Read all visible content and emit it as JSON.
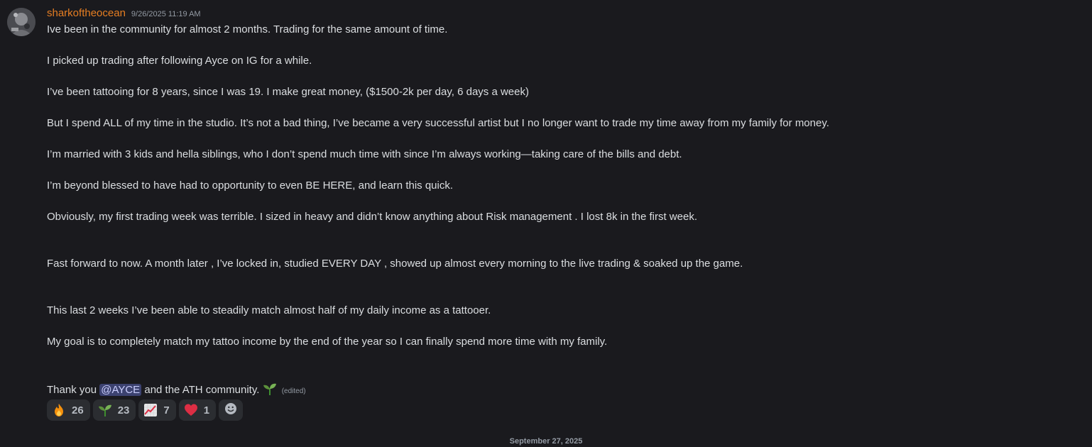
{
  "message": {
    "username": "sharkoftheocean",
    "timestamp": "9/26/2025 11:19 AM",
    "username_color": "#e67e22",
    "lines": [
      "Ive been in the community for almost 2 months. Trading for the same amount of time.",
      "I picked up trading after following Ayce on IG for a while.",
      "I’ve been tattooing for 8 years, since I was 19. I make great money, ($1500-2k per day, 6 days a week)",
      "But I spend ALL of my time in the studio. It’s not a bad thing, I’ve became a very successful artist but I no longer want to trade my time away from my family for money.",
      "I’m married with 3 kids and hella siblings, who I don’t spend much time with since I’m always working—taking care of the bills and debt.",
      "I’m beyond blessed to have had to opportunity to even BE HERE, and learn this quick.",
      "Obviously, my first trading week was terrible. I sized in heavy and didn’t know anything about Risk management . I lost 8k in the first week.",
      "Fast forward to now. A month later , I’ve locked in, studied EVERY DAY , showed up almost every morning to the live trading & soaked up the game.",
      "This last 2 weeks I’ve been able to steadily match almost half of my daily income as a tattooer.",
      "My goal is to completely match my tattoo income by the end of the year so I can finally spend more time with my family."
    ],
    "final_line": {
      "prefix": "Thank you ",
      "mention": "@AYCE",
      "suffix": " and the ATH community.",
      "emoji": "seedling-icon",
      "edited": "(edited)"
    }
  },
  "reactions": [
    {
      "emoji": "fire-icon",
      "count": "26"
    },
    {
      "emoji": "seedling-icon",
      "count": "23"
    },
    {
      "emoji": "chart-increasing-icon",
      "count": "7"
    },
    {
      "emoji": "red-heart-icon",
      "count": "1"
    }
  ],
  "add_reaction": {
    "icon": "add-reaction-icon"
  },
  "date_divider": "September 27, 2025",
  "colors": {
    "background": "#1a1a1e",
    "text": "#dbdee1",
    "mention_bg": "#3c4270",
    "mention_text": "#c9cdfb",
    "reaction_bg": "#2b2d31",
    "muted": "#949ba4"
  }
}
